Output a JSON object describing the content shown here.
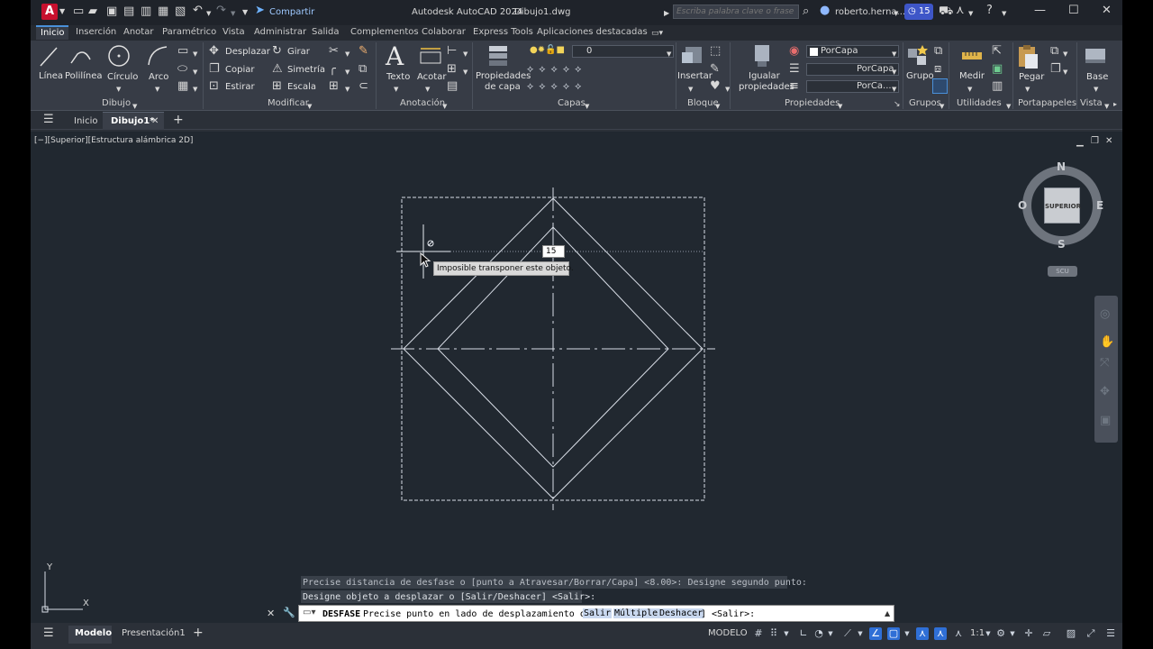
{
  "window": {
    "title": "Autodesk AutoCAD 2024",
    "document": "Dibujo1.dwg",
    "share_label": "Compartir",
    "search_placeholder": "Escriba palabra clave o frase",
    "user": "roberto.herna...",
    "badge_count": "15"
  },
  "ribbon_tabs": [
    "Inicio",
    "Inserción",
    "Anotar",
    "Paramétrico",
    "Vista",
    "Administrar",
    "Salida",
    "Complementos",
    "Colaborar",
    "Express Tools",
    "Aplicaciones destacadas"
  ],
  "panels": {
    "dibujo": {
      "label": "Dibujo",
      "linea": "Línea",
      "polilinea": "Polilínea",
      "circulo": "Círculo",
      "arco": "Arco"
    },
    "modificar": {
      "label": "Modificar",
      "desplazar": "Desplazar",
      "girar": "Girar",
      "copiar": "Copiar",
      "simetria": "Simetría",
      "estirar": "Estirar",
      "escala": "Escala"
    },
    "anotacion": {
      "label": "Anotación",
      "texto": "Texto",
      "acotar": "Acotar"
    },
    "capas": {
      "label": "Capas",
      "propiedades_line1": "Propiedades",
      "propiedades_line2": "de capa",
      "current_layer": "0"
    },
    "bloque": {
      "label": "Bloque",
      "insertar": "Insertar"
    },
    "propiedades": {
      "label": "Propiedades",
      "igualar_line1": "Igualar",
      "igualar_line2": "propiedades",
      "color": "PorCapa",
      "linetype": "PorCapa",
      "lineweight": "PorCa..."
    },
    "grupos": {
      "label": "Grupos",
      "grupo": "Grupo"
    },
    "utilidades": {
      "label": "Utilidades",
      "medir": "Medir"
    },
    "portapapeles": {
      "label": "Portapapeles",
      "pegar": "Pegar"
    },
    "vista": {
      "label": "Vista",
      "base": "Base"
    }
  },
  "doc_tabs": {
    "start": "Inicio",
    "current": "Dibujo1*"
  },
  "viewport": {
    "label": "[−][Superior][Estructura alámbrica 2D]",
    "tooltip": "Imposible transponer este objeto.",
    "dim_input": "15",
    "viewcube": {
      "face": "SUPERIOR",
      "n": "N",
      "s": "S",
      "e": "E",
      "w": "O",
      "ucs": "SCU"
    },
    "axis_x": "X",
    "axis_y": "Y"
  },
  "command": {
    "history1": "Precise distancia de desfase o [punto a Atravesar/Borrar/Capa] <8.00>:  Designe segundo punto:",
    "history2": "Designe objeto a desplazar o [Salir/Deshacer] <Salir>:",
    "cmd_name": "DESFASE",
    "prompt": "Precise punto en lado de desplazamiento o [",
    "opt1": "Salir",
    "opt2": "Múltiple",
    "opt3": "Deshacer",
    "prompt_end": "] <Salir>:"
  },
  "status": {
    "layout_tabs": [
      "Modelo",
      "Presentación1"
    ],
    "mode": "MODELO",
    "scale": "1:1"
  },
  "colors": {
    "accent": "#2f6fd6",
    "viewport_bg": "#212830",
    "geometry": "#d8dde6"
  }
}
